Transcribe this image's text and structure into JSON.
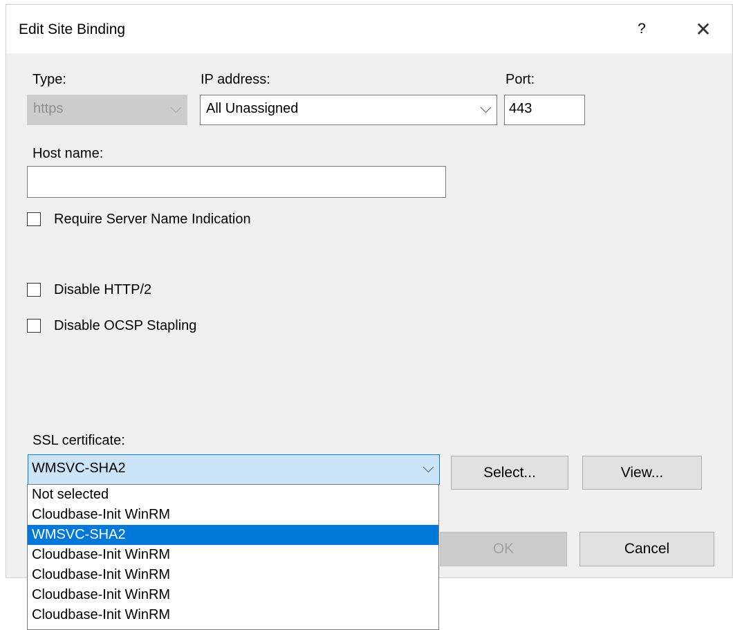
{
  "window": {
    "title": "Edit Site Binding",
    "help_label": "?",
    "close_label": "✕"
  },
  "type": {
    "label": "Type:",
    "value": "https",
    "enabled": false
  },
  "ip_address": {
    "label": "IP address:",
    "value": "All Unassigned"
  },
  "port": {
    "label": "Port:",
    "value": "443"
  },
  "host_name": {
    "label": "Host name:",
    "value": ""
  },
  "checkboxes": {
    "sni": {
      "label": "Require Server Name Indication",
      "checked": false
    },
    "http2": {
      "label": "Disable HTTP/2",
      "checked": false
    },
    "ocsp": {
      "label": "Disable OCSP Stapling",
      "checked": false
    }
  },
  "ssl_certificate": {
    "label": "SSL certificate:",
    "value": "WMSVC-SHA2",
    "options": [
      "Not selected",
      "Cloudbase-Init WinRM",
      "WMSVC-SHA2",
      "Cloudbase-Init WinRM",
      "Cloudbase-Init WinRM",
      "Cloudbase-Init WinRM",
      "Cloudbase-Init WinRM"
    ],
    "highlighted_index": 2
  },
  "buttons": {
    "select": "Select...",
    "view": "View...",
    "ok": "OK",
    "cancel": "Cancel"
  },
  "colors": {
    "highlight": "#0078d7",
    "combo_focus_bg": "#cce4f7",
    "dialog_bg": "#f0f0f0"
  }
}
